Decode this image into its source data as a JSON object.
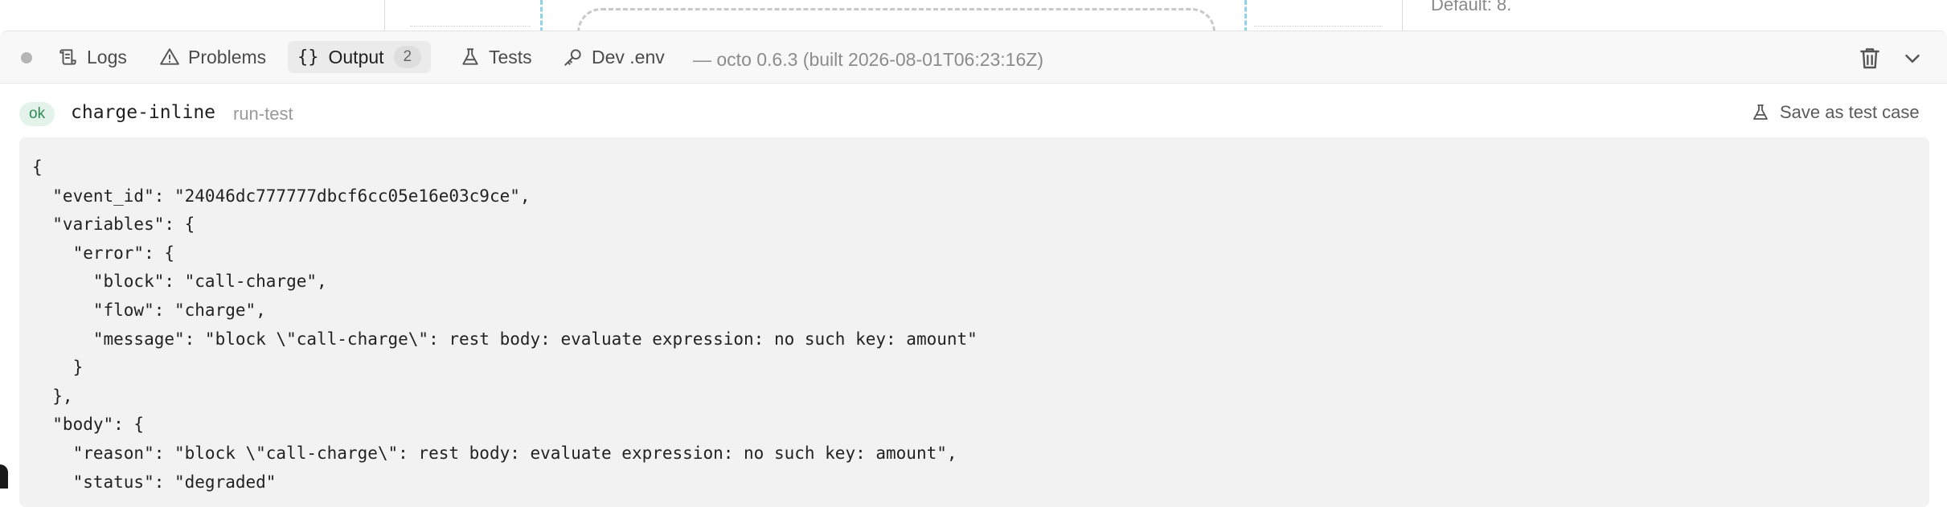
{
  "background": {
    "side_text": "Default: 8."
  },
  "bottom_panel": {
    "tabs": [
      {
        "label": "Logs",
        "icon": "scroll-icon"
      },
      {
        "label": "Problems",
        "icon": "warning-triangle-icon"
      },
      {
        "label": "Output",
        "icon": "braces-icon",
        "badge": "2",
        "active": true
      },
      {
        "label": "Tests",
        "icon": "flask-icon"
      },
      {
        "label": "Dev .env",
        "icon": "key-icon"
      }
    ],
    "version": "— octo 0.6.3 (built 2026-08-01T06:23:16Z)",
    "actions": {
      "clear": "trash-icon",
      "collapse": "chevron-down-icon"
    }
  },
  "output": {
    "status": "ok",
    "name": "charge-inline",
    "kind": "run-test",
    "save_label": "Save as test case",
    "payload": "{\n  \"event_id\": \"24046dc777777dbcf6cc05e16e03c9ce\",\n  \"variables\": {\n    \"error\": {\n      \"block\": \"call-charge\",\n      \"flow\": \"charge\",\n      \"message\": \"block \\\"call-charge\\\": rest body: evaluate expression: no such key: amount\"\n    }\n  },\n  \"body\": {\n    \"reason\": \"block \\\"call-charge\\\": rest body: evaluate expression: no such key: amount\",\n    \"status\": \"degraded\""
  },
  "colors": {
    "ok_bg": "#e3f3ea",
    "ok_text": "#2f8a57",
    "code_bg": "#f2f2f2",
    "canvas_dash": "#8fd3e8"
  }
}
